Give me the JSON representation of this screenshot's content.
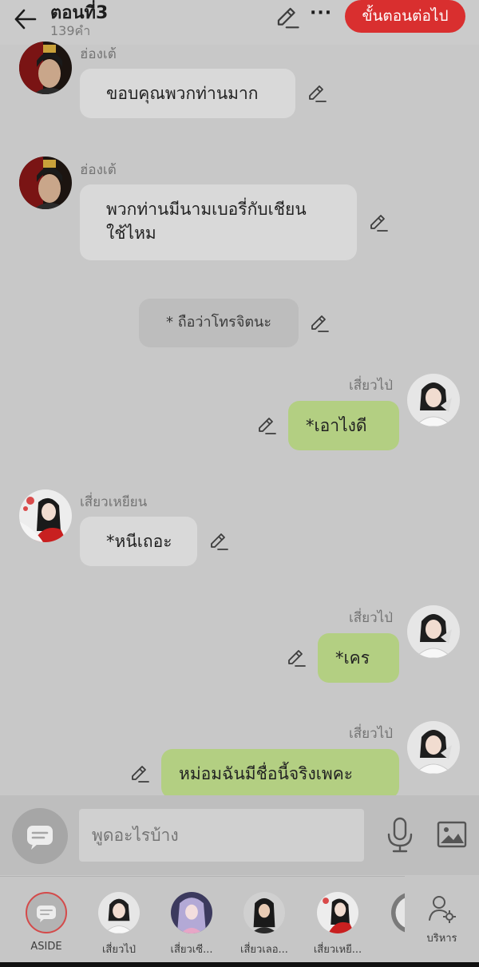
{
  "header": {
    "title": "ตอนที่3",
    "subtitle": "139คำ",
    "next_label": "ขั้นตอนต่อไป"
  },
  "messages": [
    {
      "name": "ฮ่องเต้",
      "text": "ขอบคุณพวกท่านมาก"
    },
    {
      "name": "ฮ่องเต้",
      "text_line1": "พวกท่านมีนามเบอรี่กับเชียน",
      "text_line2": "ใช้ไหม"
    },
    {
      "text": "* ถือว่าโทรจิตนะ"
    },
    {
      "name": "เสี่ยวไป่",
      "text": "*เอาไงดี"
    },
    {
      "name": "เสี่ยวเหยียน",
      "text": "*หนีเถอะ"
    },
    {
      "name": "เสี่ยวไป่",
      "text": "*เคร"
    },
    {
      "name": "เสี่ยวไป่",
      "text": "หม่อมฉันมีชื่อนี้จริงเพคะ"
    }
  ],
  "input": {
    "placeholder": "พูดอะไรบ้าง"
  },
  "tabs": [
    {
      "label": "ASIDE"
    },
    {
      "label": "เสี่ยวไป่"
    },
    {
      "label": "เสี่ยวเซี..."
    },
    {
      "label": "เสี่ยวเลอ..."
    },
    {
      "label": "เสี่ยวเหยี..."
    },
    {
      "label": "บริหาร"
    }
  ],
  "colors": {
    "accent": "#d92f2f",
    "right_bubble": "#b3cf82",
    "left_bubble": "#d9d9d9",
    "background": "#c8c8c8"
  }
}
